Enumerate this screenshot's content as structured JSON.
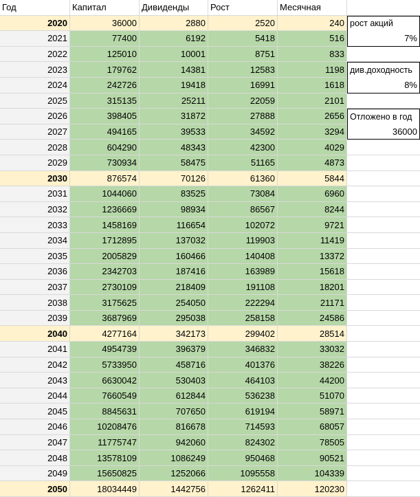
{
  "headers": [
    "Год",
    "Капитал",
    "Дивиденды",
    "Рост",
    "Месячная"
  ],
  "highlight_years": [
    "2020",
    "2030",
    "2040",
    "2050"
  ],
  "rows": [
    [
      "2020",
      "36000",
      "2880",
      "2520",
      "240"
    ],
    [
      "2021",
      "77400",
      "6192",
      "5418",
      "516"
    ],
    [
      "2022",
      "125010",
      "10001",
      "8751",
      "833"
    ],
    [
      "2023",
      "179762",
      "14381",
      "12583",
      "1198"
    ],
    [
      "2024",
      "242726",
      "19418",
      "16991",
      "1618"
    ],
    [
      "2025",
      "315135",
      "25211",
      "22059",
      "2101"
    ],
    [
      "2026",
      "398405",
      "31872",
      "27888",
      "2656"
    ],
    [
      "2027",
      "494165",
      "39533",
      "34592",
      "3294"
    ],
    [
      "2028",
      "604290",
      "48343",
      "42300",
      "4029"
    ],
    [
      "2029",
      "730934",
      "58475",
      "51165",
      "4873"
    ],
    [
      "2030",
      "876574",
      "70126",
      "61360",
      "5844"
    ],
    [
      "2031",
      "1044060",
      "83525",
      "73084",
      "6960"
    ],
    [
      "2032",
      "1236669",
      "98934",
      "86567",
      "8244"
    ],
    [
      "2033",
      "1458169",
      "116654",
      "102072",
      "9721"
    ],
    [
      "2034",
      "1712895",
      "137032",
      "119903",
      "11419"
    ],
    [
      "2035",
      "2005829",
      "160466",
      "140408",
      "13372"
    ],
    [
      "2036",
      "2342703",
      "187416",
      "163989",
      "15618"
    ],
    [
      "2037",
      "2730109",
      "218409",
      "191108",
      "18201"
    ],
    [
      "2038",
      "3175625",
      "254050",
      "222294",
      "21171"
    ],
    [
      "2039",
      "3687969",
      "295038",
      "258158",
      "24586"
    ],
    [
      "2040",
      "4277164",
      "342173",
      "299402",
      "28514"
    ],
    [
      "2041",
      "4954739",
      "396379",
      "346832",
      "33032"
    ],
    [
      "2042",
      "5733950",
      "458716",
      "401376",
      "38226"
    ],
    [
      "2043",
      "6630042",
      "530403",
      "464103",
      "44200"
    ],
    [
      "2044",
      "7660549",
      "612844",
      "536238",
      "51070"
    ],
    [
      "2045",
      "8845631",
      "707650",
      "619194",
      "58971"
    ],
    [
      "2046",
      "10208476",
      "816678",
      "714593",
      "68057"
    ],
    [
      "2047",
      "11775747",
      "942060",
      "824302",
      "78505"
    ],
    [
      "2048",
      "13578109",
      "1086249",
      "950468",
      "90521"
    ],
    [
      "2049",
      "15650825",
      "1252066",
      "1095558",
      "104339"
    ],
    [
      "2050",
      "18034449",
      "1442756",
      "1262411",
      "120230"
    ]
  ],
  "params": [
    {
      "label": "рост акций",
      "value": "7%"
    },
    {
      "label": "див.доходность",
      "value": "8%"
    },
    {
      "label": "Отложено в год",
      "value": "36000"
    }
  ],
  "colors": {
    "header_bg": "#ffffff",
    "year_bg": "#f3f3f3",
    "highlight_bg": "#fff2cc",
    "data_bg": "#b6d7a8",
    "grid_line": "#d9d9d9"
  }
}
